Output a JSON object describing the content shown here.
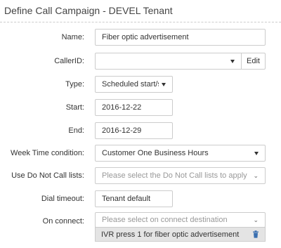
{
  "header": {
    "title": "Define Call Campaign - DEVEL Tenant"
  },
  "form": {
    "name": {
      "label": "Name:",
      "value": "Fiber optic advertisement"
    },
    "caller_id": {
      "label": "CallerID:",
      "value": "",
      "edit_label": "Edit"
    },
    "type": {
      "label": "Type:",
      "value": "Scheduled start/sto"
    },
    "start": {
      "label": "Start:",
      "value": "2016-12-22"
    },
    "end": {
      "label": "End:",
      "value": "2016-12-29"
    },
    "week_time": {
      "label": "Week Time condition:",
      "value": "Customer One Business Hours"
    },
    "dnc": {
      "label": "Use Do Not Call lists:",
      "placeholder": "Please select the Do Not Call lists to apply"
    },
    "dial_timeout": {
      "label": "Dial timeout:",
      "value": "Tenant default"
    },
    "on_connect": {
      "label": "On connect:",
      "placeholder": "Please select on connect destination",
      "selected": "IVR press 1 for fiber optic advertisement"
    }
  },
  "icons": {
    "dropdown": "caret-down-icon",
    "chevron": "chevron-down-icon",
    "remove": "trash-icon"
  },
  "colors": {
    "field_border": "#cccccc",
    "chip_bg": "#e4e4e4",
    "trash_icon": "#3a6fb0"
  }
}
